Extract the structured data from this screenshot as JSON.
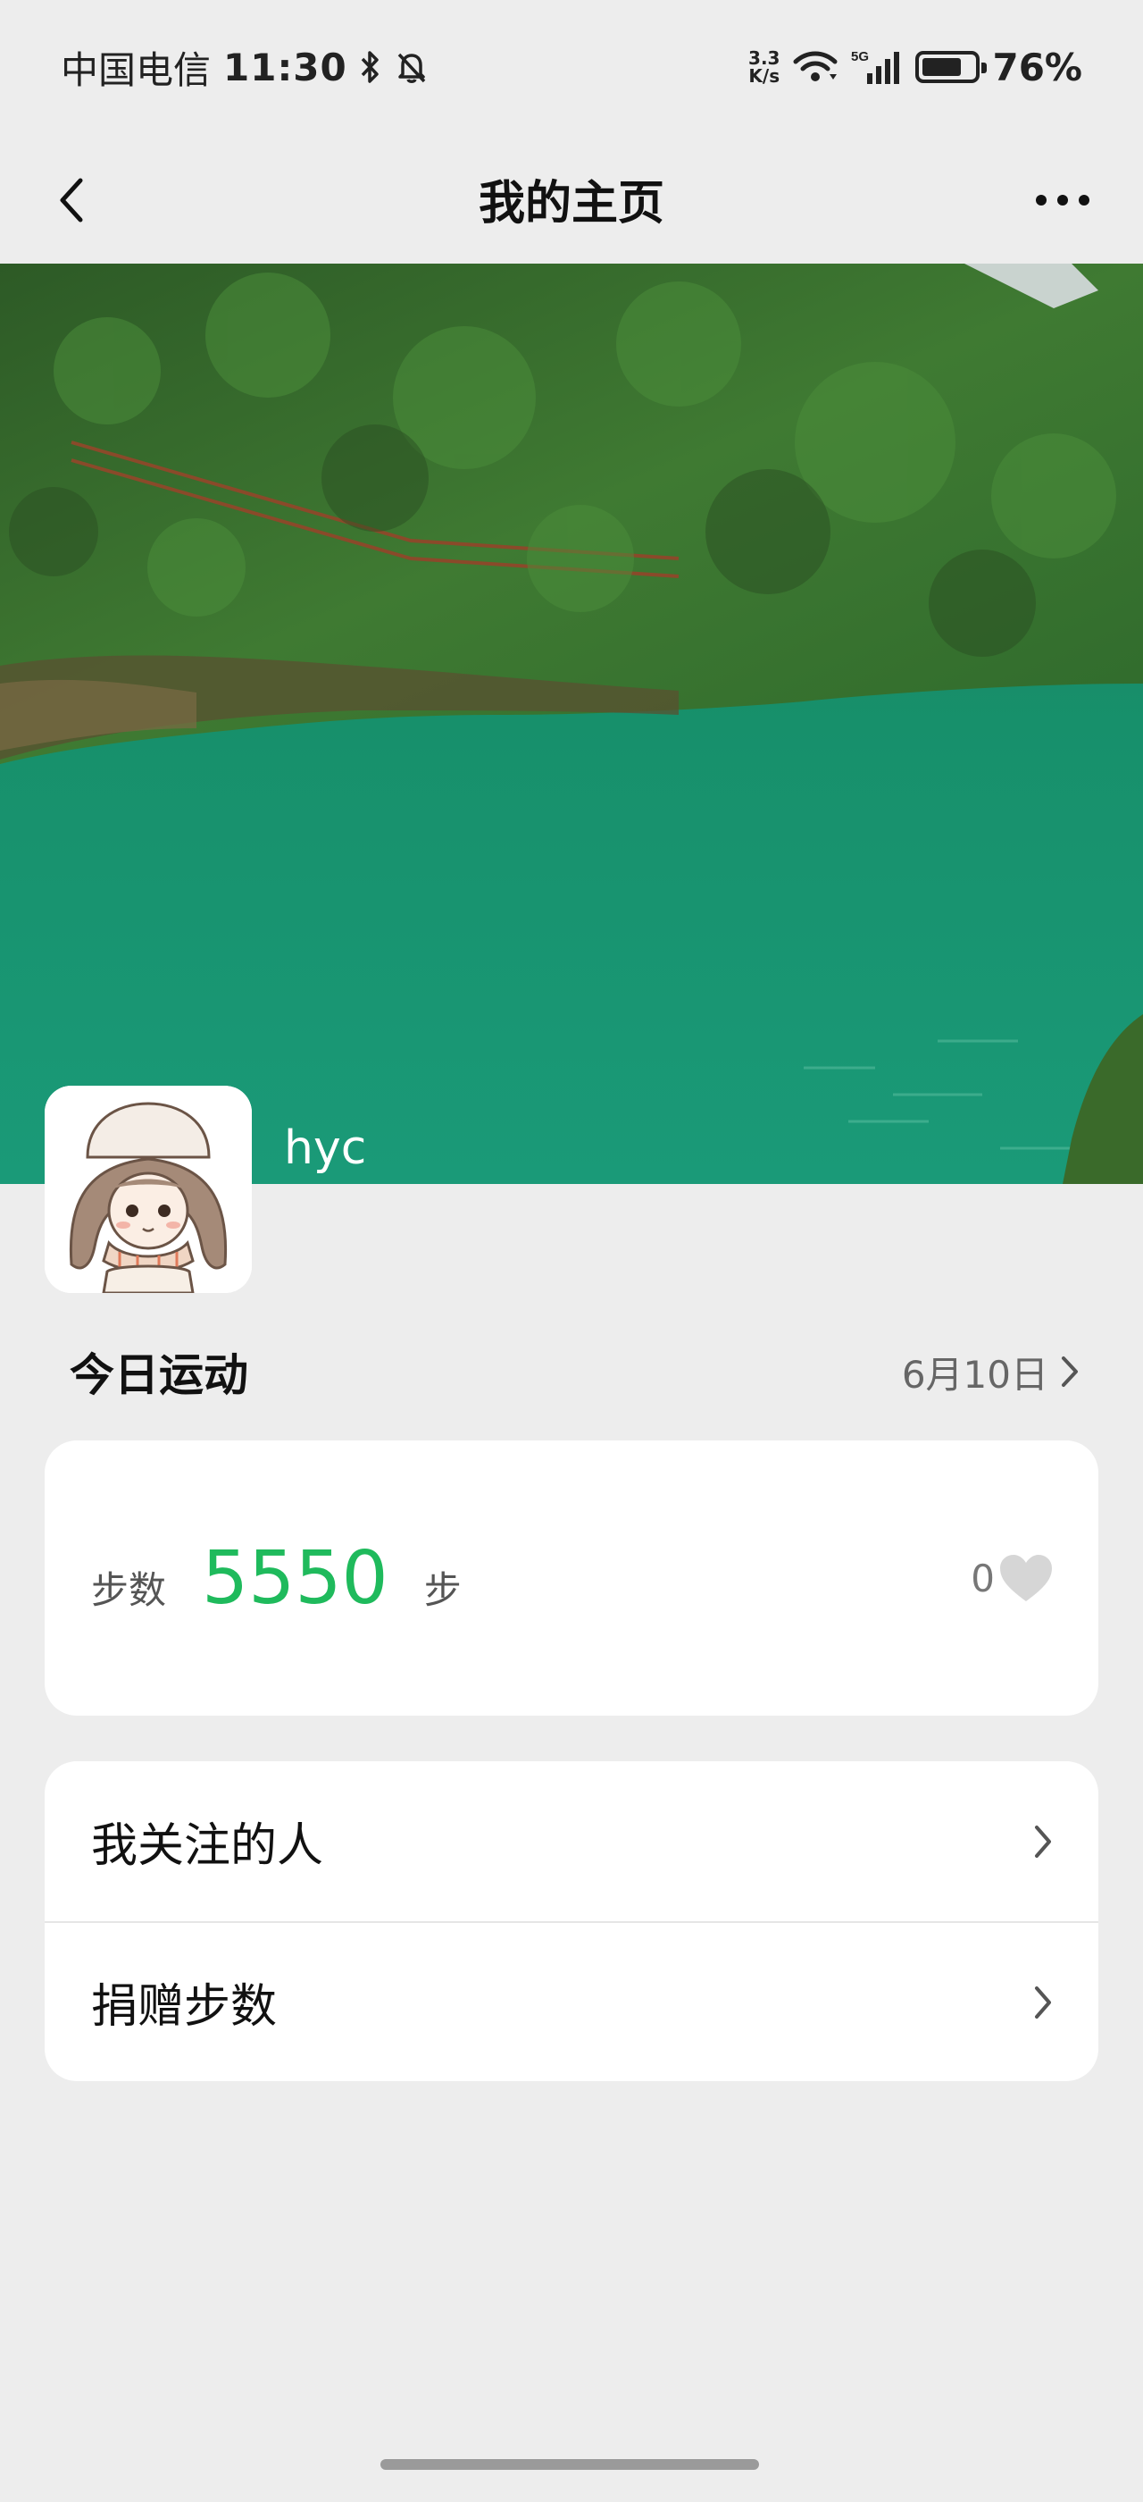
{
  "status_bar": {
    "carrier": "中国电信",
    "time": "11:30",
    "network_speed_top": "3.3",
    "network_speed_bottom": "K/s",
    "network_type": "5G",
    "battery": "76%",
    "battery_level": 0.76
  },
  "nav": {
    "title": "我的主页",
    "back_icon": "chevron-left-icon",
    "more_icon": "more-dots-icon"
  },
  "profile": {
    "username": "hyc"
  },
  "today": {
    "title": "今日运动",
    "date": "6月10日"
  },
  "steps": {
    "label": "步数",
    "value": "5550",
    "unit": "步",
    "likes": "0"
  },
  "menu": {
    "items": [
      {
        "label": "我关注的人"
      },
      {
        "label": "捐赠步数"
      }
    ]
  },
  "colors": {
    "accent": "#1fba5c",
    "background": "#ededed"
  }
}
